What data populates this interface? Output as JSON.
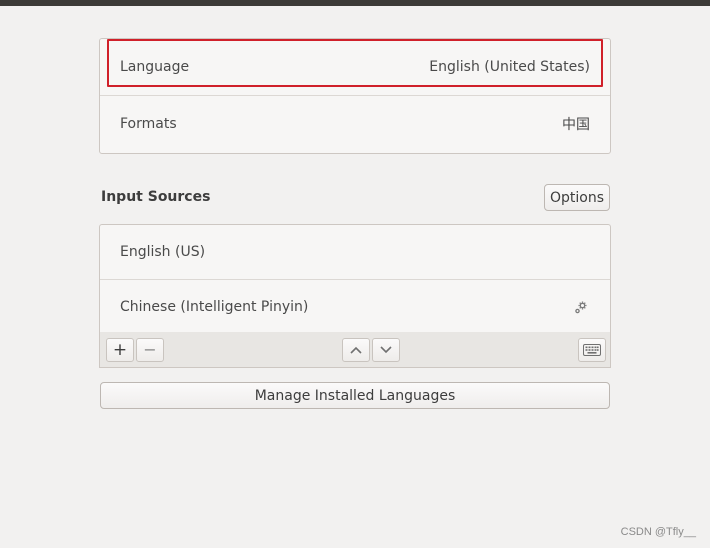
{
  "language_panel": {
    "language_label": "Language",
    "language_value": "English (United States)",
    "formats_label": "Formats",
    "formats_value": "中国"
  },
  "input_sources": {
    "title": "Input Sources",
    "options_label": "Options",
    "items": [
      {
        "label": "English (US)"
      },
      {
        "label": "Chinese (Intelligent Pinyin)",
        "icon": "gear-icon"
      }
    ]
  },
  "toolbar": {
    "add_symbol": "+",
    "remove_symbol": "−",
    "icons": [
      "add-icon",
      "remove-icon",
      "chevron-up-icon",
      "chevron-down-icon",
      "keyboard-icon"
    ]
  },
  "manage_button_label": "Manage Installed Languages",
  "watermark": "CSDN @Tfly__",
  "colors": {
    "highlight": "#d0202a",
    "background": "#f2f1f0"
  }
}
